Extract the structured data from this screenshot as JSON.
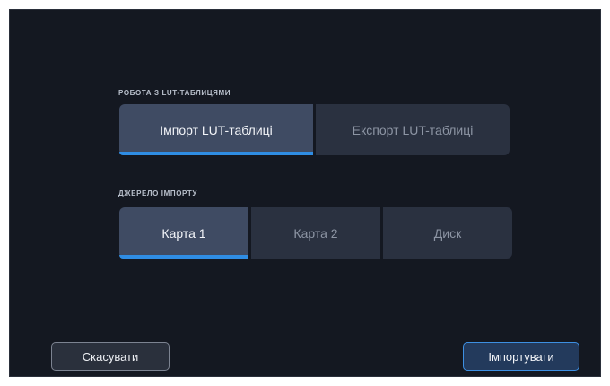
{
  "lut_section": {
    "label": "РОБОТА З LUT-ТАБЛИЦЯМИ",
    "options": [
      {
        "label": "Імпорт LUT-таблиці",
        "selected": true
      },
      {
        "label": "Експорт LUT-таблиці",
        "selected": false
      }
    ]
  },
  "source_section": {
    "label": "ДЖЕРЕЛО ІМПОРТУ",
    "options": [
      {
        "label": "Карта 1",
        "selected": true
      },
      {
        "label": "Карта 2",
        "selected": false
      },
      {
        "label": "Диск",
        "selected": false
      }
    ]
  },
  "footer": {
    "cancel_label": "Скасувати",
    "import_label": "Імпортувати"
  },
  "colors": {
    "background": "#141821",
    "segment": "#2a3140",
    "segment_selected": "#3f4b63",
    "accent": "#2f8de4"
  }
}
